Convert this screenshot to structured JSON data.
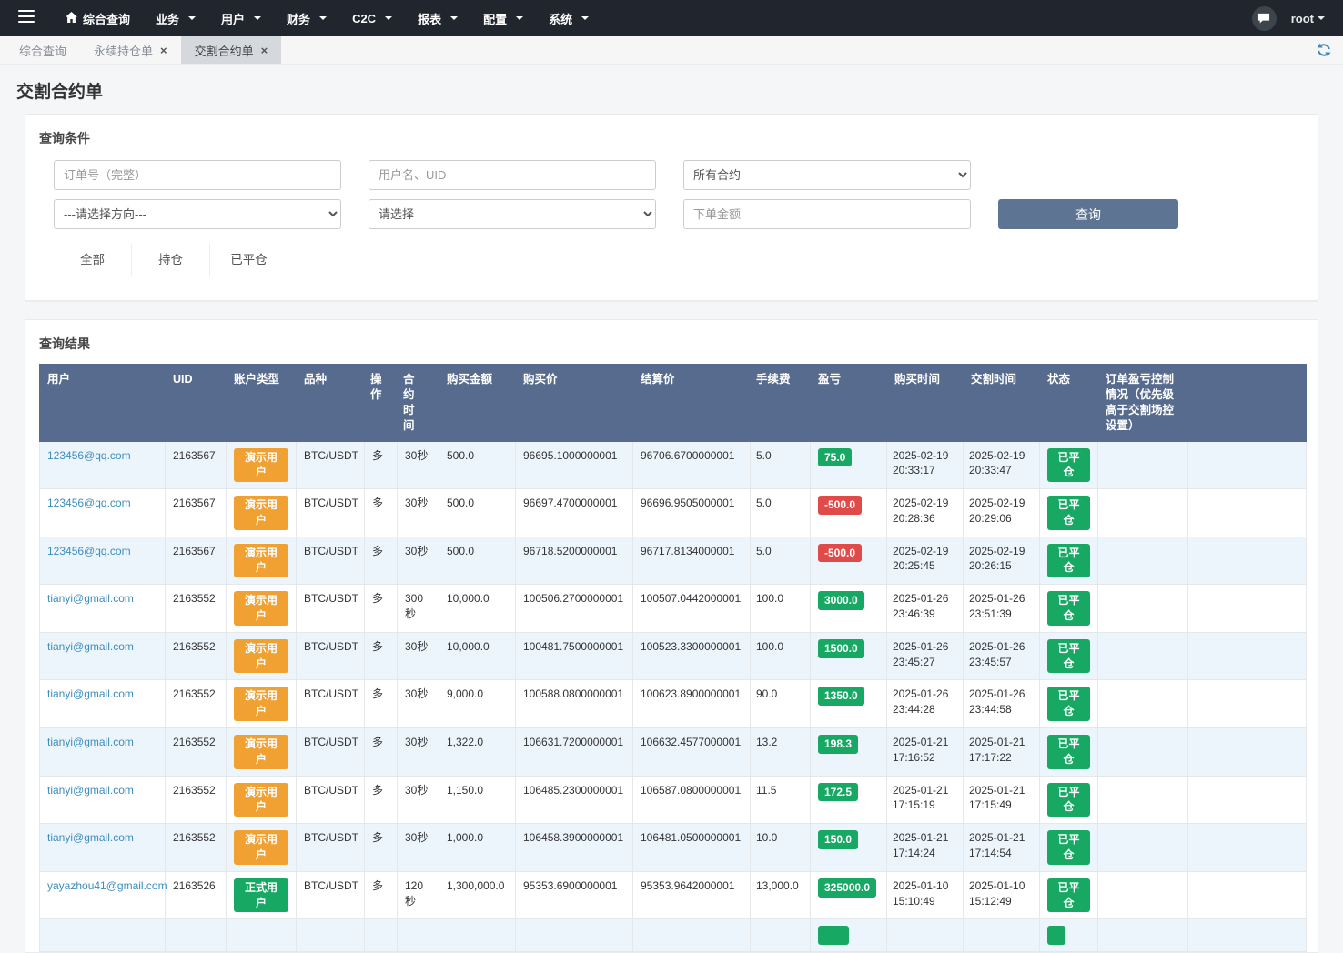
{
  "icons": {
    "close": "×"
  },
  "navbar": {
    "user": "root",
    "items": [
      {
        "label": "综合查询"
      },
      {
        "label": "业务"
      },
      {
        "label": "用户"
      },
      {
        "label": "财务"
      },
      {
        "label": "C2C"
      },
      {
        "label": "报表"
      },
      {
        "label": "配置"
      },
      {
        "label": "系统"
      }
    ]
  },
  "tabs": [
    {
      "label": "综合查询",
      "closable": false,
      "active": false
    },
    {
      "label": "永续持仓单",
      "closable": true,
      "active": false
    },
    {
      "label": "交割合约单",
      "closable": true,
      "active": true
    }
  ],
  "page_title": "交割合约单",
  "query_panel": {
    "title": "查询条件",
    "order_no_placeholder": "订单号（完整）",
    "user_placeholder": "用户名、UID",
    "contract_select": "所有合约",
    "direction_select": "---请选择方向---",
    "status_select": "请选择",
    "amount_placeholder": "下单金额",
    "search_button": "查询",
    "filter_tabs": [
      "全部",
      "持仓",
      "已平仓"
    ]
  },
  "results": {
    "title": "查询结果",
    "columns": [
      "用户",
      "UID",
      "账户类型",
      "品种",
      "操作",
      "合约时间",
      "购买金额",
      "购买价",
      "结算价",
      "手续费",
      "盈亏",
      "购买时间",
      "交割时间",
      "状态",
      "订单盈亏控制情况（优先级高于交割场控设置）"
    ],
    "rows": [
      {
        "user": "123456@qq.com",
        "uid": "2163567",
        "account_type": "演示用户",
        "account_kind": "demo",
        "symbol": "BTC/USDT",
        "direction": "多",
        "duration": "30秒",
        "amount": "500.0",
        "buy_price": "96695.1000000001",
        "settle_price": "96706.6700000001",
        "fee": "5.0",
        "pnl": "75.0",
        "pnl_type": "pos",
        "buy_date": "2025-02-19",
        "buy_clock": "20:33:17",
        "settle_date": "2025-02-19",
        "settle_clock": "20:33:47",
        "status": "已平仓",
        "status_badge": true
      },
      {
        "user": "123456@qq.com",
        "uid": "2163567",
        "account_type": "演示用户",
        "account_kind": "demo",
        "symbol": "BTC/USDT",
        "direction": "多",
        "duration": "30秒",
        "amount": "500.0",
        "buy_price": "96697.4700000001",
        "settle_price": "96696.9505000001",
        "fee": "5.0",
        "pnl": "-500.0",
        "pnl_type": "neg",
        "buy_date": "2025-02-19",
        "buy_clock": "20:28:36",
        "settle_date": "2025-02-19",
        "settle_clock": "20:29:06",
        "status": "已平仓",
        "status_badge": true
      },
      {
        "user": "123456@qq.com",
        "uid": "2163567",
        "account_type": "演示用户",
        "account_kind": "demo",
        "symbol": "BTC/USDT",
        "direction": "多",
        "duration": "30秒",
        "amount": "500.0",
        "buy_price": "96718.5200000001",
        "settle_price": "96717.8134000001",
        "fee": "5.0",
        "pnl": "-500.0",
        "pnl_type": "neg",
        "buy_date": "2025-02-19",
        "buy_clock": "20:25:45",
        "settle_date": "2025-02-19",
        "settle_clock": "20:26:15",
        "status": "已平仓",
        "status_badge": true
      },
      {
        "user": "tianyi@gmail.com",
        "uid": "2163552",
        "account_type": "演示用户",
        "account_kind": "demo",
        "symbol": "BTC/USDT",
        "direction": "多",
        "duration": "300秒",
        "amount": "10,000.0",
        "buy_price": "100506.2700000001",
        "settle_price": "100507.0442000001",
        "fee": "100.0",
        "pnl": "3000.0",
        "pnl_type": "pos",
        "buy_date": "2025-01-26",
        "buy_clock": "23:46:39",
        "settle_date": "2025-01-26",
        "settle_clock": "23:51:39",
        "status": "已平仓",
        "status_badge": true
      },
      {
        "user": "tianyi@gmail.com",
        "uid": "2163552",
        "account_type": "演示用户",
        "account_kind": "demo",
        "symbol": "BTC/USDT",
        "direction": "多",
        "duration": "30秒",
        "amount": "10,000.0",
        "buy_price": "100481.7500000001",
        "settle_price": "100523.3300000001",
        "fee": "100.0",
        "pnl": "1500.0",
        "pnl_type": "pos",
        "buy_date": "2025-01-26",
        "buy_clock": "23:45:27",
        "settle_date": "2025-01-26",
        "settle_clock": "23:45:57",
        "status": "已平仓",
        "status_badge": true
      },
      {
        "user": "tianyi@gmail.com",
        "uid": "2163552",
        "account_type": "演示用户",
        "account_kind": "demo",
        "symbol": "BTC/USDT",
        "direction": "多",
        "duration": "30秒",
        "amount": "9,000.0",
        "buy_price": "100588.0800000001",
        "settle_price": "100623.8900000001",
        "fee": "90.0",
        "pnl": "1350.0",
        "pnl_type": "pos",
        "buy_date": "2025-01-26",
        "buy_clock": "23:44:28",
        "settle_date": "2025-01-26",
        "settle_clock": "23:44:58",
        "status": "已平仓",
        "status_badge": true
      },
      {
        "user": "tianyi@gmail.com",
        "uid": "2163552",
        "account_type": "演示用户",
        "account_kind": "demo",
        "symbol": "BTC/USDT",
        "direction": "多",
        "duration": "30秒",
        "amount": "1,322.0",
        "buy_price": "106631.7200000001",
        "settle_price": "106632.4577000001",
        "fee": "13.2",
        "pnl": "198.3",
        "pnl_type": "pos",
        "buy_date": "2025-01-21",
        "buy_clock": "17:16:52",
        "settle_date": "2025-01-21",
        "settle_clock": "17:17:22",
        "status": "已平仓",
        "status_badge": true
      },
      {
        "user": "tianyi@gmail.com",
        "uid": "2163552",
        "account_type": "演示用户",
        "account_kind": "demo",
        "symbol": "BTC/USDT",
        "direction": "多",
        "duration": "30秒",
        "amount": "1,150.0",
        "buy_price": "106485.2300000001",
        "settle_price": "106587.0800000001",
        "fee": "11.5",
        "pnl": "172.5",
        "pnl_type": "pos",
        "buy_date": "2025-01-21",
        "buy_clock": "17:15:19",
        "settle_date": "2025-01-21",
        "settle_clock": "17:15:49",
        "status": "已平仓",
        "status_badge": true
      },
      {
        "user": "tianyi@gmail.com",
        "uid": "2163552",
        "account_type": "演示用户",
        "account_kind": "demo",
        "symbol": "BTC/USDT",
        "direction": "多",
        "duration": "30秒",
        "amount": "1,000.0",
        "buy_price": "106458.3900000001",
        "settle_price": "106481.0500000001",
        "fee": "10.0",
        "pnl": "150.0",
        "pnl_type": "pos",
        "buy_date": "2025-01-21",
        "buy_clock": "17:14:24",
        "settle_date": "2025-01-21",
        "settle_clock": "17:14:54",
        "status": "已平仓",
        "status_badge": true
      },
      {
        "user": "yayazhou41@gmail.com",
        "uid": "2163526",
        "account_type": "正式用户",
        "account_kind": "formal",
        "symbol": "BTC/USDT",
        "direction": "多",
        "duration": "120秒",
        "amount": "1,300,000.0",
        "buy_price": "95353.6900000001",
        "settle_price": "95353.9642000001",
        "fee": "13,000.0",
        "pnl": "325000.0",
        "pnl_type": "pos",
        "buy_date": "2025-01-10",
        "buy_clock": "15:10:49",
        "settle_date": "2025-01-10",
        "settle_clock": "15:12:49",
        "status": "已平仓",
        "status_badge": true
      },
      {
        "partial": true,
        "user": "",
        "uid": "",
        "account_type": "",
        "account_kind": "",
        "symbol": "",
        "direction": "",
        "duration": "",
        "amount": "",
        "buy_price": "",
        "settle_price": "",
        "fee": "",
        "pnl": "",
        "pnl_type": "pos",
        "buy_date": "",
        "buy_clock": "",
        "settle_date": "",
        "settle_clock": "",
        "status": "",
        "status_badge": true
      }
    ]
  }
}
